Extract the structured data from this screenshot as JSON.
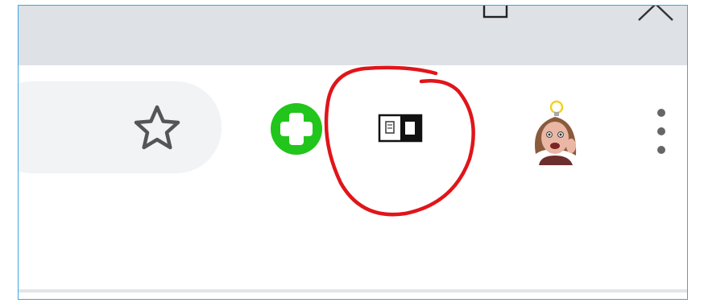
{
  "window": {
    "restore_icon": "restore-window-icon",
    "close_icon": "close-window-icon",
    "titlebar_color": "#dee1e6"
  },
  "toolbar": {
    "omnibox_color": "#f1f3f4",
    "bookmark_icon": "star-icon",
    "extensions": [
      {
        "icon": "green-plus-extension-icon",
        "color": "#22c51b"
      },
      {
        "icon": "reader-view-extension-icon",
        "color": "#111111"
      }
    ],
    "profile_icon": "avatar",
    "menu_icon": "three-dot-menu-icon"
  },
  "annotation": {
    "shape": "hand-drawn-circle",
    "color": "#e0151a"
  },
  "frame_border_color": "#3ea6e5"
}
